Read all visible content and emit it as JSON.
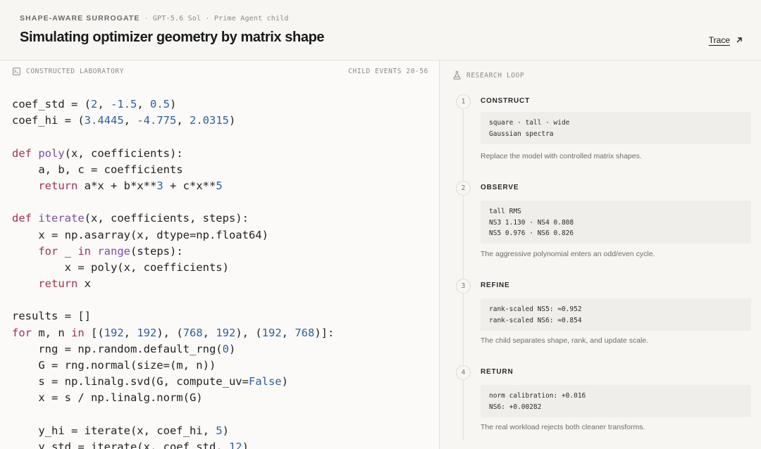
{
  "header": {
    "brand": "SHAPE-AWARE SURROGATE",
    "separator": "·",
    "model": "GPT-5.6 Sol · Prime Agent child",
    "title": "Simulating optimizer geometry by matrix shape",
    "trace_label": "Trace"
  },
  "lab": {
    "label": "CONSTRUCTED LABORATORY",
    "events": "CHILD EVENTS 20-56",
    "icon": "terminal-icon",
    "code_lines": [
      [
        {
          "t": "coef_std = ("
        },
        {
          "t": "2",
          "c": "num"
        },
        {
          "t": ", "
        },
        {
          "t": "-1.5",
          "c": "num"
        },
        {
          "t": ", "
        },
        {
          "t": "0.5",
          "c": "num"
        },
        {
          "t": ")"
        }
      ],
      [
        {
          "t": "coef_hi = ("
        },
        {
          "t": "3.4445",
          "c": "num"
        },
        {
          "t": ", "
        },
        {
          "t": "-4.775",
          "c": "num"
        },
        {
          "t": ", "
        },
        {
          "t": "2.0315",
          "c": "num"
        },
        {
          "t": ")"
        }
      ],
      [],
      [
        {
          "t": "def",
          "c": "kw"
        },
        {
          "t": " "
        },
        {
          "t": "poly",
          "c": "fn"
        },
        {
          "t": "(x, coefficients):"
        }
      ],
      [
        {
          "t": "    a, b, c = coefficients"
        }
      ],
      [
        {
          "t": "    "
        },
        {
          "t": "return",
          "c": "kw"
        },
        {
          "t": " a*x + b*x**"
        },
        {
          "t": "3",
          "c": "num"
        },
        {
          "t": " + c*x**"
        },
        {
          "t": "5",
          "c": "num"
        }
      ],
      [],
      [
        {
          "t": "def",
          "c": "kw"
        },
        {
          "t": " "
        },
        {
          "t": "iterate",
          "c": "fn"
        },
        {
          "t": "(x, coefficients, steps):"
        }
      ],
      [
        {
          "t": "    x = np.asarray(x, dtype=np.float64)"
        }
      ],
      [
        {
          "t": "    "
        },
        {
          "t": "for",
          "c": "kw"
        },
        {
          "t": " _ "
        },
        {
          "t": "in",
          "c": "kw"
        },
        {
          "t": " "
        },
        {
          "t": "range",
          "c": "fn"
        },
        {
          "t": "(steps):"
        }
      ],
      [
        {
          "t": "        x = poly(x, coefficients)"
        }
      ],
      [
        {
          "t": "    "
        },
        {
          "t": "return",
          "c": "kw"
        },
        {
          "t": " x"
        }
      ],
      [],
      [
        {
          "t": "results = []"
        }
      ],
      [
        {
          "t": "for",
          "c": "kw"
        },
        {
          "t": " m, n "
        },
        {
          "t": "in",
          "c": "kw"
        },
        {
          "t": " [("
        },
        {
          "t": "192",
          "c": "num"
        },
        {
          "t": ", "
        },
        {
          "t": "192",
          "c": "num"
        },
        {
          "t": "), ("
        },
        {
          "t": "768",
          "c": "num"
        },
        {
          "t": ", "
        },
        {
          "t": "192",
          "c": "num"
        },
        {
          "t": "), ("
        },
        {
          "t": "192",
          "c": "num"
        },
        {
          "t": ", "
        },
        {
          "t": "768",
          "c": "num"
        },
        {
          "t": ")]:"
        }
      ],
      [
        {
          "t": "    rng = np.random.default_rng("
        },
        {
          "t": "0",
          "c": "num"
        },
        {
          "t": ")"
        }
      ],
      [
        {
          "t": "    G = rng.normal(size=(m, n))"
        }
      ],
      [
        {
          "t": "    s = np.linalg.svd(G, compute_uv="
        },
        {
          "t": "False",
          "c": "num"
        },
        {
          "t": ")"
        }
      ],
      [
        {
          "t": "    x = s / np.linalg.norm(G)"
        }
      ],
      [],
      [
        {
          "t": "    y_hi = iterate(x, coef_hi, "
        },
        {
          "t": "5",
          "c": "num"
        },
        {
          "t": ")"
        }
      ],
      [
        {
          "t": "    y_std = iterate(x, coef_std, "
        },
        {
          "t": "12",
          "c": "num"
        },
        {
          "t": ")"
        }
      ]
    ]
  },
  "loop": {
    "label": "RESEARCH LOOP",
    "icon": "flask-icon",
    "steps": [
      {
        "num": "1",
        "title": "CONSTRUCT",
        "box": "square · tall · wide\nGaussian spectra",
        "note": "Replace the model with controlled matrix shapes."
      },
      {
        "num": "2",
        "title": "OBSERVE",
        "box": "tall RMS\nNS3 1.130 · NS4 0.808\nNS5 0.976 · NS6 0.826",
        "note": "The aggressive polynomial enters an odd/even cycle."
      },
      {
        "num": "3",
        "title": "REFINE",
        "box": "rank-scaled NS5: ≈0.952\nrank-scaled NS6: ≈0.854",
        "note": "The child separates shape, rank, and update scale."
      },
      {
        "num": "4",
        "title": "RETURN",
        "box": "norm calibration: +0.016\nNS6: +0.00282",
        "note": "The real workload rejects both cleaner transforms."
      }
    ]
  }
}
